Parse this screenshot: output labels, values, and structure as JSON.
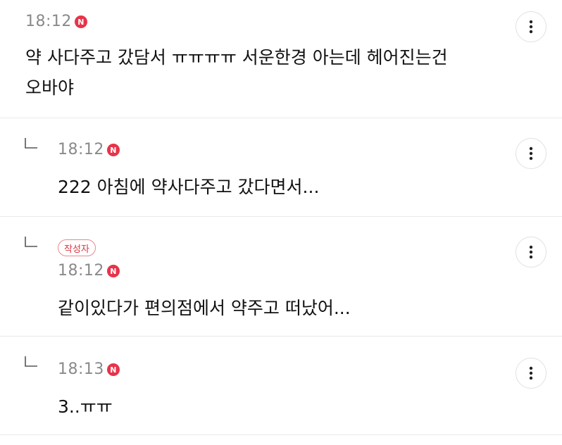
{
  "comments": [
    {
      "time": "18:12",
      "badge": "N",
      "text": "약 사다주고 갔담서 ㅠㅠㅠㅠ 서운한경 아는데 헤어진는건\n오바야"
    },
    {
      "time": "18:12",
      "badge": "N",
      "text": "222 아침에 약사다주고 갔다면서..."
    },
    {
      "author_label": "작성자",
      "time": "18:12",
      "badge": "N",
      "text": "같이있다가 편의점에서 약주고 떠났어..."
    },
    {
      "time": "18:13",
      "badge": "N",
      "text": "3..ㅠㅠ"
    }
  ],
  "icons": {
    "more": "more-vertical-icon",
    "reply": "reply-arrow-icon",
    "new": "new-badge-icon"
  },
  "colors": {
    "new_badge": "#e6344a",
    "author_badge": "#d9343d",
    "divider": "#e9e9e9",
    "meta_text": "#8a8a8a"
  }
}
